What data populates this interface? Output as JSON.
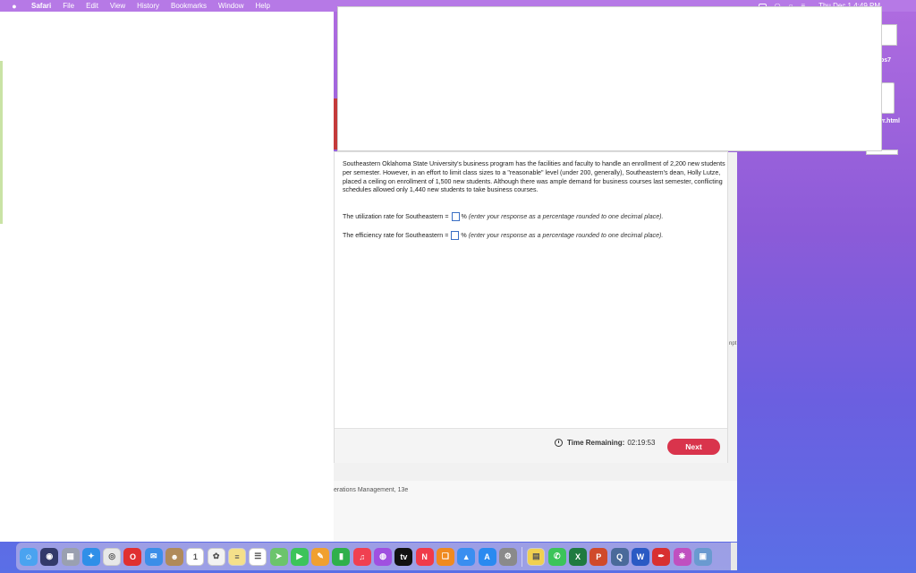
{
  "menubar": {
    "app": "Safari",
    "items": [
      "File",
      "Edit",
      "View",
      "History",
      "Bookmarks",
      "Window",
      "Help"
    ],
    "clock": "Thu Dec 1 4:49 PM"
  },
  "desktop": {
    "file_label_1": "ps7",
    "file_label_2": "yr.html"
  },
  "question": {
    "text": "Southeastern Oklahoma State University's business program has the facilities and faculty to handle an enrollment of 2,200 new students per semester. However, in an effort to limit class sizes to a \"reasonable\" level (under 200, generally), Southeastern's dean, Holly Lutze, placed a ceiling on enrollment of 1,500 new students.  Although there was ample demand for business courses last semester, conflicting schedules allowed only 1,440 new students to take business courses.",
    "utilization_label": "The utilization rate for Southeastern =",
    "utilization_value": "",
    "efficiency_label": "The efficiency rate for Southeastern =",
    "efficiency_value": "",
    "unit": "%",
    "hint": "(enter your response as a percentage rounded to one decimal place)."
  },
  "footer": {
    "time_label": "Time Remaining:",
    "time_value": "02:19:53",
    "next_label": "Next"
  },
  "page_footer": "erations Management, 13e",
  "side_fragment": "npt",
  "dock": {
    "icons": [
      {
        "name": "finder-icon",
        "color": "#4aa3f0",
        "glyph": "☺"
      },
      {
        "name": "siri-icon",
        "color": "#333a6a",
        "glyph": "◉"
      },
      {
        "name": "launchpad-icon",
        "color": "#9aa0b0",
        "glyph": "▦"
      },
      {
        "name": "safari-icon",
        "color": "#2f8fe8",
        "glyph": "✦"
      },
      {
        "name": "chrome-icon",
        "color": "#e8e8e8",
        "glyph": "◎"
      },
      {
        "name": "opera-icon",
        "color": "#e03030",
        "glyph": "O"
      },
      {
        "name": "mail-icon",
        "color": "#3c8ee8",
        "glyph": "✉"
      },
      {
        "name": "contacts-icon",
        "color": "#b08a5a",
        "glyph": "☻"
      },
      {
        "name": "calendar-icon",
        "color": "#ffffff",
        "glyph": "1"
      },
      {
        "name": "photos-icon",
        "color": "#f2f2f2",
        "glyph": "✿"
      },
      {
        "name": "notes-icon",
        "color": "#f5e08a",
        "glyph": "≡"
      },
      {
        "name": "reminders-icon",
        "color": "#ffffff",
        "glyph": "☰"
      },
      {
        "name": "maps-icon",
        "color": "#6cc46c",
        "glyph": "➤"
      },
      {
        "name": "facetime-icon",
        "color": "#3cc45a",
        "glyph": "▶"
      },
      {
        "name": "pencil-icon",
        "color": "#f0a030",
        "glyph": "✎"
      },
      {
        "name": "numbers-icon",
        "color": "#2fb04a",
        "glyph": "▮"
      },
      {
        "name": "music-icon",
        "color": "#f04050",
        "glyph": "♫"
      },
      {
        "name": "podcasts-icon",
        "color": "#a050e0",
        "glyph": "◍"
      },
      {
        "name": "appletv-icon",
        "color": "#111111",
        "glyph": "tv"
      },
      {
        "name": "news-icon",
        "color": "#f03a4a",
        "glyph": "N"
      },
      {
        "name": "books-icon",
        "color": "#f08a20",
        "glyph": "❏"
      },
      {
        "name": "keynote-icon",
        "color": "#3a8ef0",
        "glyph": "▲"
      },
      {
        "name": "appstore-icon",
        "color": "#2a8af0",
        "glyph": "A"
      },
      {
        "name": "settings-icon",
        "color": "#8a8a8a",
        "glyph": "⚙"
      },
      {
        "name": "stickies-icon",
        "color": "#f0d050",
        "glyph": "▤"
      },
      {
        "name": "messages-icon",
        "color": "#3cc45a",
        "glyph": "✆"
      },
      {
        "name": "excel-icon",
        "color": "#1f7a40",
        "glyph": "X"
      },
      {
        "name": "powerpoint-icon",
        "color": "#d04a2a",
        "glyph": "P"
      },
      {
        "name": "quicktime-icon",
        "color": "#4a6a9a",
        "glyph": "Q"
      },
      {
        "name": "word-icon",
        "color": "#2a5ac4",
        "glyph": "W"
      },
      {
        "name": "acrobat-icon",
        "color": "#d83030",
        "glyph": "✒"
      },
      {
        "name": "teams-icon",
        "color": "#c050c0",
        "glyph": "❋"
      },
      {
        "name": "preview-icon",
        "color": "#6a9ad0",
        "glyph": "▣"
      }
    ]
  }
}
